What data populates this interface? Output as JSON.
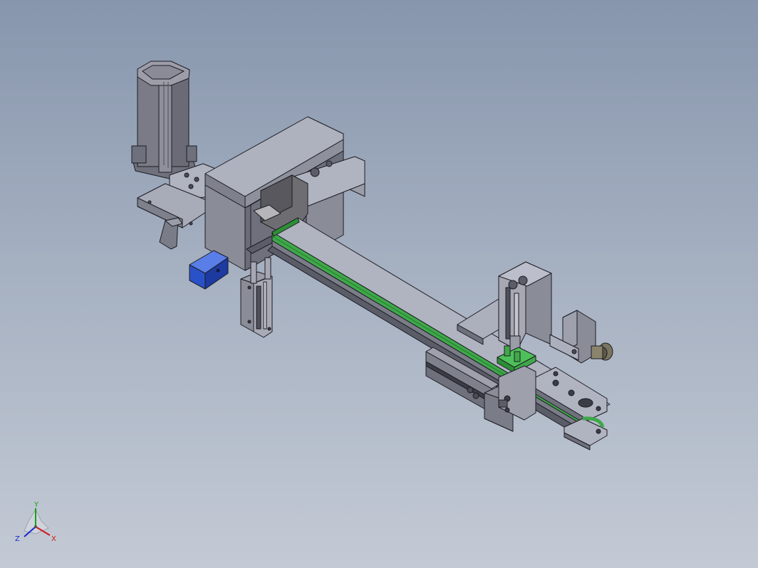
{
  "view": {
    "background_top": "#8796ad",
    "background_bottom": "#c3cad5"
  },
  "model": {
    "parts": [
      "servo-motor",
      "motor-mount-plate",
      "gantry-frame",
      "gantry-top-cover",
      "coupling-block",
      "blue-sensor",
      "vertical-cylinder",
      "conveyor-rail",
      "conveyor-belt",
      "gripper-cylinder",
      "side-bracket",
      "gripper-fingers",
      "end-pulley-plate",
      "tension-knob",
      "lower-slide-cylinder"
    ],
    "colors": {
      "metal": "#8c8f9e",
      "metal_dark": "#5e606b",
      "metal_light": "#b4b7c4",
      "belt": "#3fa84a",
      "sensor": "#2a52c8",
      "edge": "#1c1c22"
    }
  },
  "triad": {
    "x_label": "X",
    "y_label": "Y",
    "z_label": "Z",
    "x_color": "#d01818",
    "y_color": "#18a018",
    "z_color": "#1828d0"
  }
}
